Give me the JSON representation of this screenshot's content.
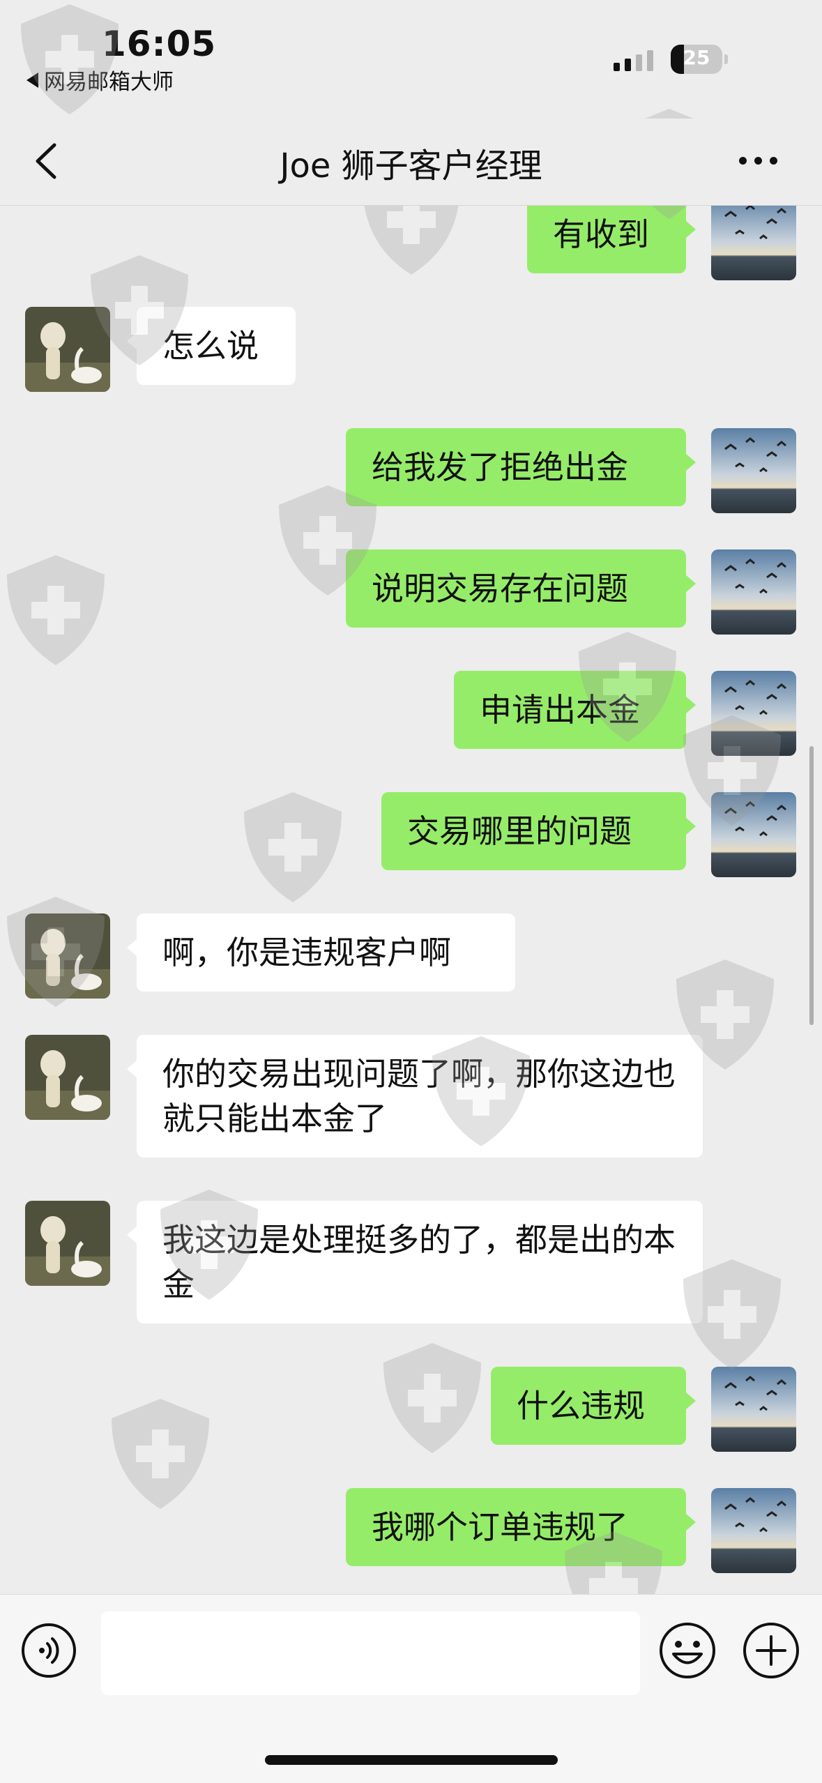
{
  "status_bar": {
    "time": "16:05",
    "back_app": "网易邮箱大师",
    "battery": "25",
    "battery_level": 0.25
  },
  "header": {
    "title": "Joe 狮子客户经理"
  },
  "messages": [
    {
      "from": "me",
      "text": "有收到"
    },
    {
      "from": "them",
      "text": "怎么说"
    },
    {
      "from": "me",
      "text": "给我发了拒绝出金"
    },
    {
      "from": "me",
      "text": "说明交易存在问题"
    },
    {
      "from": "me",
      "text": "申请出本金"
    },
    {
      "from": "me",
      "text": "交易哪里的问题"
    },
    {
      "from": "them",
      "text": "啊，你是违规客户啊"
    },
    {
      "from": "them",
      "text": "你的交易出现问题了啊，那你这边也就只能出本金了"
    },
    {
      "from": "them",
      "text": "我这边是处理挺多的了，都是出的本金"
    },
    {
      "from": "me",
      "text": "什么违规"
    },
    {
      "from": "me",
      "text": "我哪个订单违规了"
    }
  ],
  "input": {
    "value": "",
    "placeholder": ""
  },
  "colors": {
    "sent_bubble": "#95ec69",
    "received_bubble": "#ffffff",
    "background": "#ededed"
  },
  "icons": [
    "back-arrow-icon",
    "more-icon",
    "voice-icon",
    "emoji-icon",
    "plus-icon",
    "watermark-shield-icon"
  ]
}
